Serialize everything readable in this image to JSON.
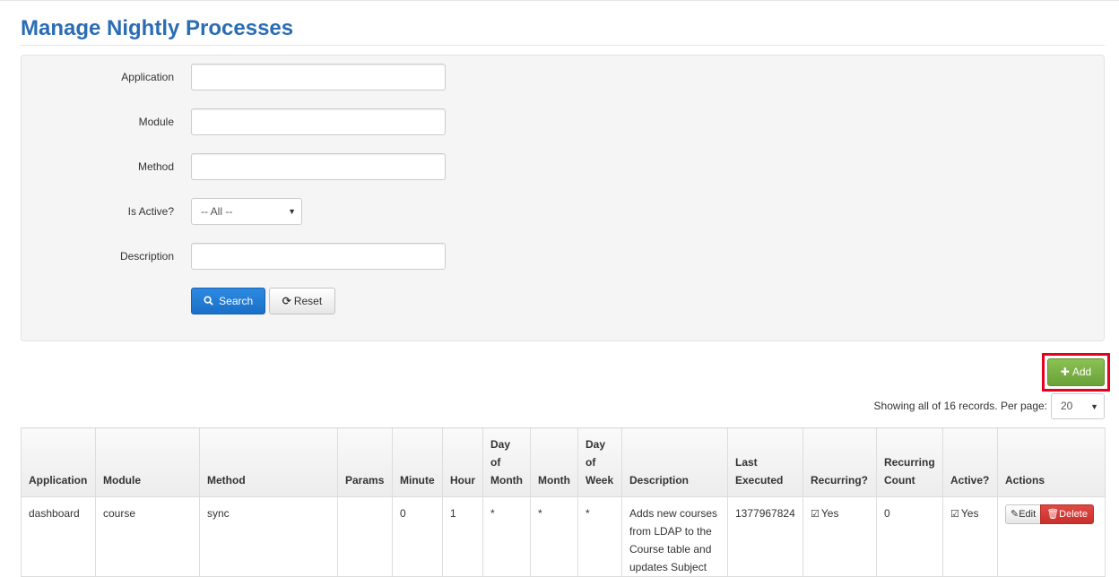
{
  "page": {
    "title": "Manage Nightly Processes"
  },
  "search_form": {
    "fields": [
      {
        "label": "Application",
        "value": ""
      },
      {
        "label": "Module",
        "value": ""
      },
      {
        "label": "Method",
        "value": ""
      },
      {
        "label": "Is Active?",
        "selected": "-- All --"
      },
      {
        "label": "Description",
        "value": ""
      }
    ],
    "search_label": "Search",
    "reset_label": "Reset"
  },
  "toolbar": {
    "add_label": "Add"
  },
  "pagination": {
    "info": "Showing all of 16 records. Per page:",
    "per_page": "20"
  },
  "table": {
    "columns": [
      "Application",
      "Module",
      "Method",
      "Params",
      "Minute",
      "Hour",
      "Day of Month",
      "Month",
      "Day of Week",
      "Description",
      "Last Executed",
      "Recurring?",
      "Recurring Count",
      "Active?",
      "Actions"
    ],
    "rows": [
      {
        "application": "dashboard",
        "module": "course",
        "method": "sync",
        "params": "",
        "minute": "0",
        "hour": "1",
        "day_of_month": "*",
        "month": "*",
        "day_of_week": "*",
        "description": "Adds new courses from LDAP to the Course table and updates Subject",
        "last_executed": "1377967824",
        "recurring": "Yes",
        "recurring_count": "0",
        "active": "Yes",
        "edit_label": "Edit",
        "delete_label": "Delete"
      }
    ]
  },
  "colors": {
    "title": "#2a6db5",
    "primary": "#1a6fc7",
    "success": "#6aa23a",
    "danger": "#c9302c",
    "highlight": "#e8001c"
  },
  "icons": {
    "search": "search-icon",
    "reset": "refresh-icon",
    "add": "plus-icon",
    "edit": "pencil-icon",
    "delete": "trash-icon",
    "check": "checkbox-checked-icon"
  }
}
